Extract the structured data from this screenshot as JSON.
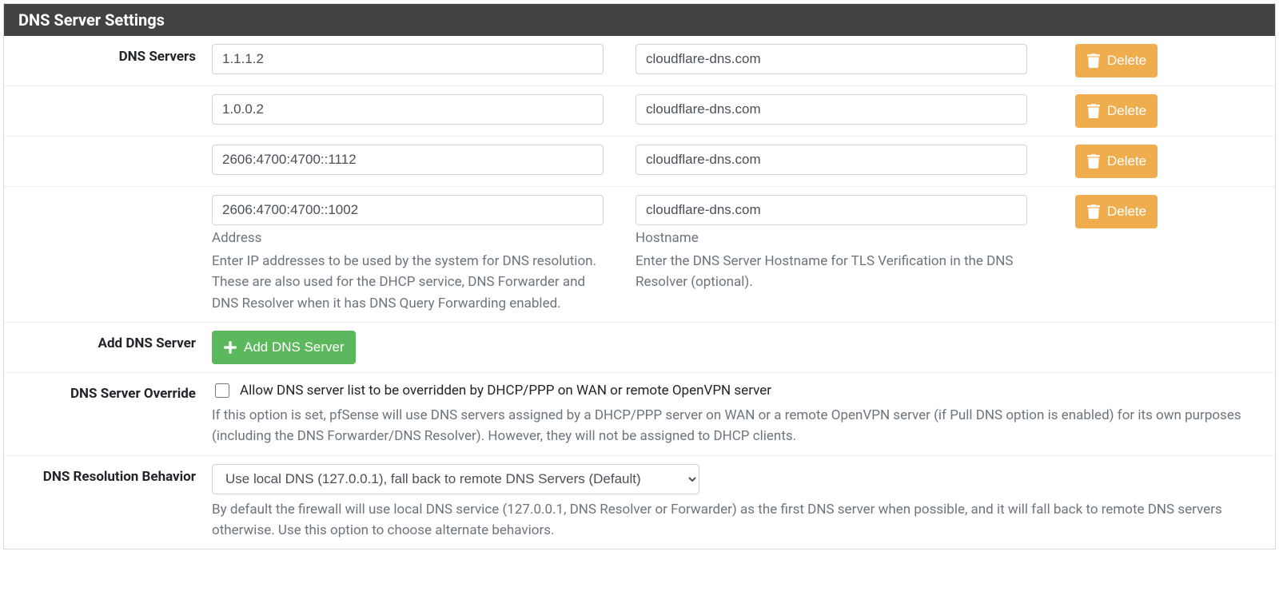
{
  "panel": {
    "title": "DNS Server Settings"
  },
  "labels": {
    "dns_servers": "DNS Servers",
    "add_dns_server": "Add DNS Server",
    "dns_server_override": "DNS Server Override",
    "dns_resolution_behavior": "DNS Resolution Behavior"
  },
  "dns_servers": [
    {
      "address": "1.1.1.2",
      "hostname": "cloudflare-dns.com"
    },
    {
      "address": "1.0.0.2",
      "hostname": "cloudflare-dns.com"
    },
    {
      "address": "2606:4700:4700::1112",
      "hostname": "cloudflare-dns.com"
    },
    {
      "address": "2606:4700:4700::1002",
      "hostname": "cloudflare-dns.com"
    }
  ],
  "buttons": {
    "delete": "Delete",
    "add_dns_server": "Add DNS Server"
  },
  "help": {
    "address_label": "Address",
    "address_help": "Enter IP addresses to be used by the system for DNS resolution. These are also used for the DHCP service, DNS Forwarder and DNS Resolver when it has DNS Query Forwarding enabled.",
    "hostname_label": "Hostname",
    "hostname_help": "Enter the DNS Server Hostname for TLS Verification in the DNS Resolver (optional).",
    "override_checkbox": "Allow DNS server list to be overridden by DHCP/PPP on WAN or remote OpenVPN server",
    "override_help": "If this option is set, pfSense will use DNS servers assigned by a DHCP/PPP server on WAN or a remote OpenVPN server (if Pull DNS option is enabled) for its own purposes (including the DNS Forwarder/DNS Resolver). However, they will not be assigned to DHCP clients.",
    "resolution_help": "By default the firewall will use local DNS service (127.0.0.1, DNS Resolver or Forwarder) as the first DNS server when possible, and it will fall back to remote DNS servers otherwise. Use this option to choose alternate behaviors."
  },
  "resolution_select": "Use local DNS (127.0.0.1), fall back to remote DNS Servers (Default)"
}
